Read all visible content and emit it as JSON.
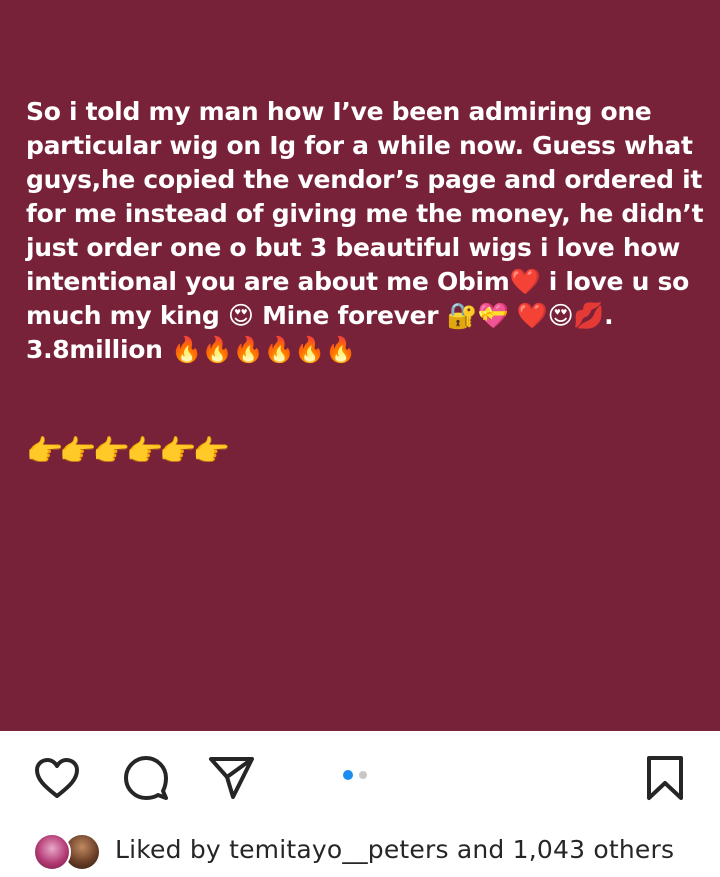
{
  "post": {
    "background_color": "#78223a",
    "caption": "So i told my man how I’ve been admiring one particular wig on Ig for a while now. Guess what guys,he copied the vendor’s page and ordered it for me instead of giving me the money, he didn’t just order one o but 3 beautiful wigs i love how intentional you are about me Obim❤️ i love u so much my king 😍 Mine forever 🔐💝 ❤️😍💋.\n3.8million 🔥🔥🔥🔥🔥🔥",
    "pointer_emojis": "👉👉👉👉👉👉"
  },
  "action_bar": {
    "like_icon": "heart-outline-icon",
    "comment_icon": "comment-bubble-icon",
    "share_icon": "paper-plane-icon",
    "save_icon": "bookmark-icon",
    "carousel": {
      "total": 2,
      "active_index": 0,
      "active_color": "#1c8cf0",
      "inactive_color": "#c7c7c7"
    }
  },
  "likes": {
    "prefix": "Liked by ",
    "user": "temitayo__peters",
    "suffix": " and 1,043 others"
  }
}
